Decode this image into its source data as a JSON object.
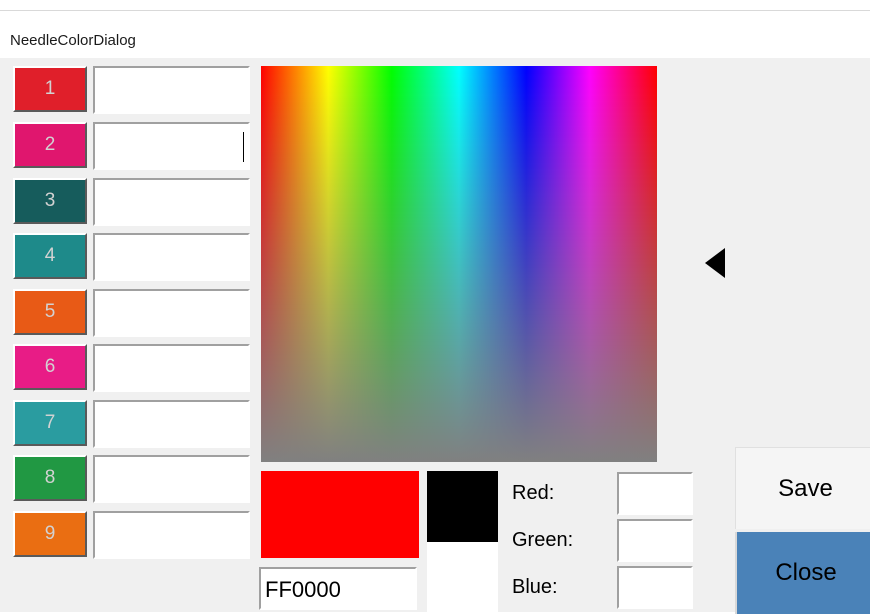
{
  "window": {
    "title": "NeedleColorDialog"
  },
  "needles": [
    {
      "label": "1",
      "color": "#e01f2a",
      "value": ""
    },
    {
      "label": "2",
      "color": "#e0166e",
      "value": ""
    },
    {
      "label": "3",
      "color": "#165c5c",
      "value": ""
    },
    {
      "label": "4",
      "color": "#1e8a8a",
      "value": ""
    },
    {
      "label": "5",
      "color": "#e85a16",
      "value": ""
    },
    {
      "label": "6",
      "color": "#e81c86",
      "value": ""
    },
    {
      "label": "7",
      "color": "#2a9ca0",
      "value": ""
    },
    {
      "label": "8",
      "color": "#219843",
      "value": ""
    },
    {
      "label": "9",
      "color": "#ea6e12",
      "value": ""
    }
  ],
  "picker": {
    "selected_color": "#ff0000",
    "hex_value": "FF0000",
    "swatch_top_color": "#000000",
    "swatch_bottom_color": "#ffffff"
  },
  "rgb": {
    "red_label": "Red:",
    "green_label": "Green:",
    "blue_label": "Blue:",
    "red_value": "",
    "green_value": "",
    "blue_value": ""
  },
  "buttons": {
    "save": "Save",
    "close": "Close"
  },
  "colors": {
    "close_button_bg": "#4a82b8",
    "dialog_bg": "#f0f0f0"
  }
}
